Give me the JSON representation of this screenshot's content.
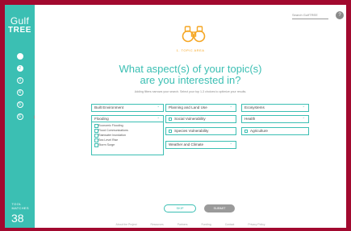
{
  "sidebar": {
    "logo": {
      "line1": "Gulf",
      "line2": "TREE"
    },
    "steps": [
      "",
      "2",
      "3",
      "4",
      "5",
      "6"
    ],
    "tool_matches": {
      "label": "Tool Matches",
      "count": "38"
    }
  },
  "header": {
    "search_placeholder": "Search GulfTREE",
    "search_icon": "?"
  },
  "main": {
    "step_label": "1. TOPIC AREA",
    "heading_line1": "What aspect(s) of your topic(s)",
    "heading_line2": "are you interested in?",
    "subtext": "Adding filters narrows your search. Select your top 1-3 choices to optimize your results."
  },
  "filters": {
    "built_environment": "Built Environment",
    "planning_land_use": "Planning and Land Use",
    "ecosystems": "Ecosystems",
    "flooding": "Flooding",
    "flooding_options": [
      "Economic Flooding",
      "Flood Communications",
      "Rainwater Inundation",
      "Sea Level Rise",
      "Storm Surge"
    ],
    "social_vulnerability": "Social Vulnerability",
    "health": "Health",
    "species_vulnerability": "Species Vulnerability",
    "agriculture": "Agriculture",
    "weather_climate": "Weather and Climate"
  },
  "buttons": {
    "skip": "SKIP",
    "submit": "SUBMIT"
  },
  "footer": [
    "About the Project",
    "Resources",
    "Partners",
    "Funding",
    "Contact",
    "Privacy Policy"
  ],
  "colors": {
    "brand_teal": "#3bbfb3",
    "frame_red": "#a2092f",
    "accent_orange": "#f5a623"
  }
}
